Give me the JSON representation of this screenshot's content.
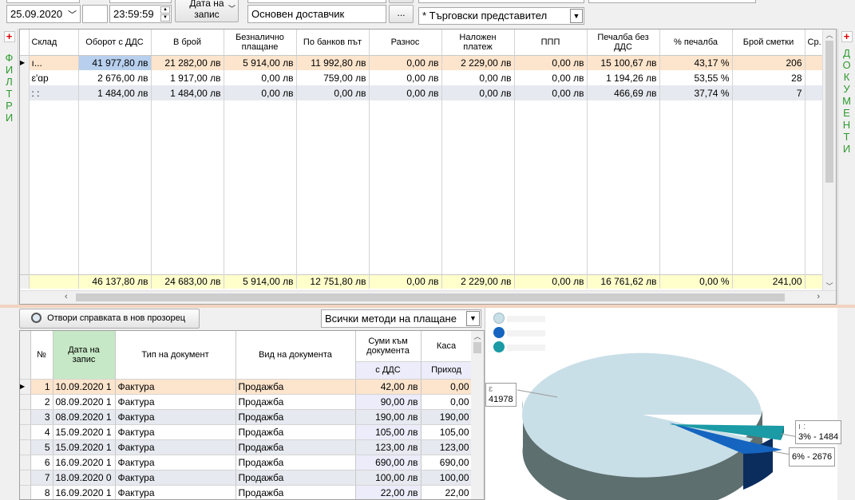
{
  "toolbar": {
    "date_to": "25.09.2020",
    "time_to": "23:59:59",
    "date_btn_line1": "Дата на",
    "date_btn_line2": "запис",
    "supplier_field": "Основен доставчик",
    "ellipsis": "...",
    "rep_select": "* Търговски представител"
  },
  "left_panel": {
    "plus": "+",
    "label": [
      "Ф",
      "И",
      "Л",
      "Т",
      "Р",
      "И"
    ]
  },
  "right_panel": {
    "plus": "+",
    "label": [
      "Д",
      "О",
      "К",
      "У",
      "М",
      "Е",
      "Н",
      "Т",
      "И"
    ]
  },
  "main_grid": {
    "headers": [
      "Склад",
      "Оборот с ДДС",
      "В брой",
      "Безналично плащане",
      "По банков път",
      "Разнос",
      "Наложен платеж",
      "ППП",
      "Печалба без ДДС",
      "% печалба",
      "Брой сметки",
      "Ср."
    ],
    "rows": [
      [
        "ı...",
        "41 977,80 лв",
        "21 282,00 лв",
        "5 914,00 лв",
        "11 992,80 лв",
        "0,00 лв",
        "2 229,00 лв",
        "0,00 лв",
        "15 100,67 лв",
        "43,17 %",
        "206",
        ""
      ],
      [
        "ɛ'ɑр",
        "2 676,00 лв",
        "1 917,00 лв",
        "0,00 лв",
        "759,00 лв",
        "0,00 лв",
        "0,00 лв",
        "0,00 лв",
        "1 194,26 лв",
        "53,55 %",
        "28",
        ""
      ],
      [
        ": :",
        "1 484,00 лв",
        "1 484,00 лв",
        "0,00 лв",
        "0,00 лв",
        "0,00 лв",
        "0,00 лв",
        "0,00 лв",
        "466,69 лв",
        "37,74 %",
        "7",
        ""
      ]
    ],
    "footer": [
      "",
      "46 137,80 лв",
      "24 683,00 лв",
      "5 914,00 лв",
      "12 751,80 лв",
      "0,00 лв",
      "2 229,00 лв",
      "0,00 лв",
      "16 761,62 лв",
      "0,00 %",
      "241,00",
      ""
    ]
  },
  "bottom": {
    "open_report_btn": "Отвори справката в нов прозорец",
    "payment_filter": "Всички методи на плащане",
    "headers": {
      "no": "№",
      "date": "Дата на запис",
      "doc_type": "Тип на документ",
      "doc_kind": "Вид на документа",
      "sums": "Суми към документа",
      "sums_sub": "с ДДС",
      "cash": "Каса",
      "cash_sub": "Приход"
    },
    "rows": [
      [
        "1",
        "10.09.2020 1",
        "Фактура",
        "Продажба",
        "42,00 лв",
        "0,00"
      ],
      [
        "2",
        "08.09.2020 1",
        "Фактура",
        "Продажба",
        "90,00 лв",
        "0,00"
      ],
      [
        "3",
        "08.09.2020 1",
        "Фактура",
        "Продажба",
        "190,00 лв",
        "190,00"
      ],
      [
        "4",
        "15.09.2020 1",
        "Фактура",
        "Продажба",
        "105,00 лв",
        "105,00"
      ],
      [
        "5",
        "15.09.2020 1",
        "Фактура",
        "Продажба",
        "123,00 лв",
        "123,00"
      ],
      [
        "6",
        "16.09.2020 1",
        "Фактура",
        "Продажба",
        "690,00 лв",
        "690,00"
      ],
      [
        "7",
        "18.09.2020 0",
        "Фактура",
        "Продажба",
        "100,00 лв",
        "100,00"
      ],
      [
        "8",
        "16.09.2020 1",
        "Фактура",
        "Продажба",
        "22,00 лв",
        "22,00"
      ]
    ]
  },
  "pie": {
    "labels": {
      "big": "41978",
      "big_prefix": "ɛ",
      "s1_top": "ı :",
      "s1": "3% - 1484",
      "s2": "6% - 2676"
    },
    "colors": {
      "big_top": "#c9dfe7",
      "big_side": "#5e6f6f",
      "teal": "#1a9ba5",
      "blue": "#1565c0",
      "navy": "#0a2d5e"
    }
  }
}
